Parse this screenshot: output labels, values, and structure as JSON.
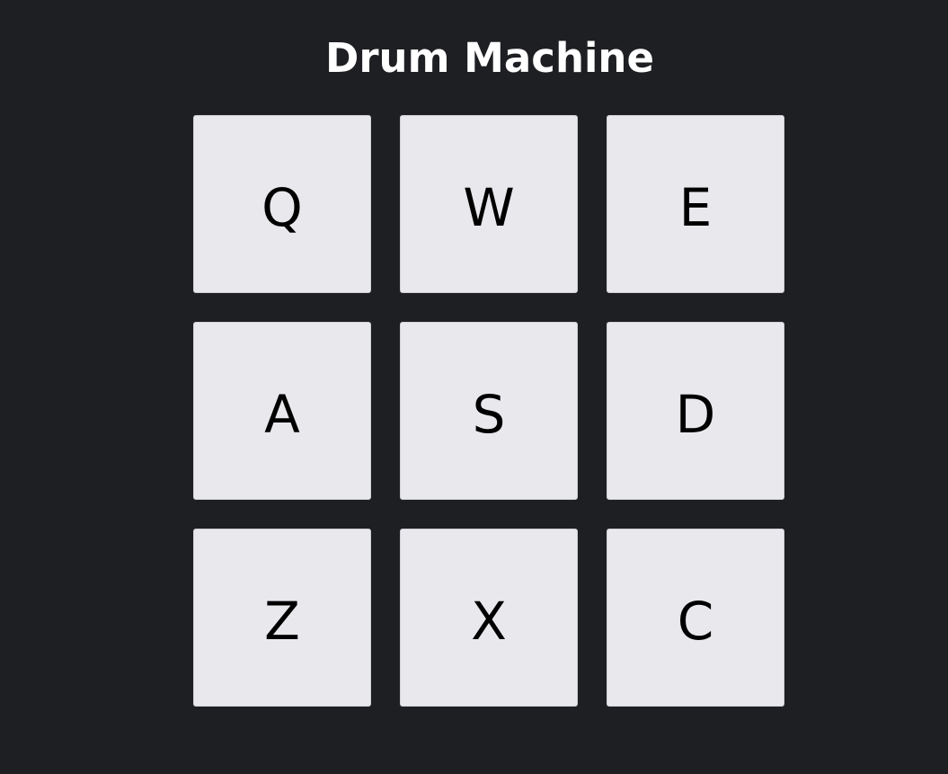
{
  "app": {
    "title": "Drum Machine"
  },
  "pads": [
    {
      "key": "Q"
    },
    {
      "key": "W"
    },
    {
      "key": "E"
    },
    {
      "key": "A"
    },
    {
      "key": "S"
    },
    {
      "key": "D"
    },
    {
      "key": "Z"
    },
    {
      "key": "X"
    },
    {
      "key": "C"
    }
  ],
  "colors": {
    "background": "#1e1f22",
    "pad": "#e9e8ed",
    "title_text": "#ffffff",
    "pad_text": "#000000"
  }
}
